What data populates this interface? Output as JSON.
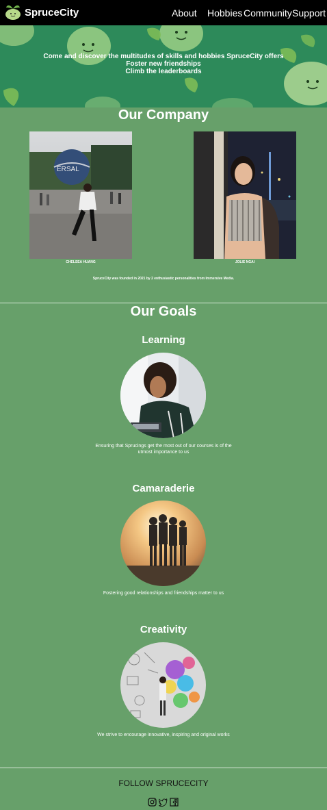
{
  "nav": {
    "brand": "SpruceCity",
    "links": [
      "About",
      "Hobbies",
      "Community",
      "Support"
    ]
  },
  "hero": {
    "lines": [
      "Come and discover the multitudes of skills and hobbies SpruceCity offers",
      "Foster new friendships",
      "Climb the leaderboards"
    ]
  },
  "company": {
    "heading": "Our Company",
    "members": [
      {
        "name": "CHELSEA HUANG"
      },
      {
        "name": "JOLIE NGAI"
      }
    ],
    "about": "SpruceCity was founded in 2021 by 2 enthusiastic personalities from Immersive Media."
  },
  "goals": {
    "heading": "Our Goals",
    "items": [
      {
        "title": "Learning",
        "desc": "Ensuring that Sprucings get the most out of our courses is of the utmost importance to us"
      },
      {
        "title": "Camaraderie",
        "desc": "Fostering good relationships and friendships matter to us"
      },
      {
        "title": "Creativity",
        "desc": "We strive to encourage innovative, inspiring and original works"
      }
    ]
  },
  "footer": {
    "follow": "FOLLOW SPRUCECITY",
    "socials": [
      "instagram-icon",
      "twitter-icon",
      "facebook-icon"
    ]
  },
  "colors": {
    "page_bg": "#67a06a",
    "nav_bg": "#000000",
    "hero_bg": "#2d8a5a"
  }
}
